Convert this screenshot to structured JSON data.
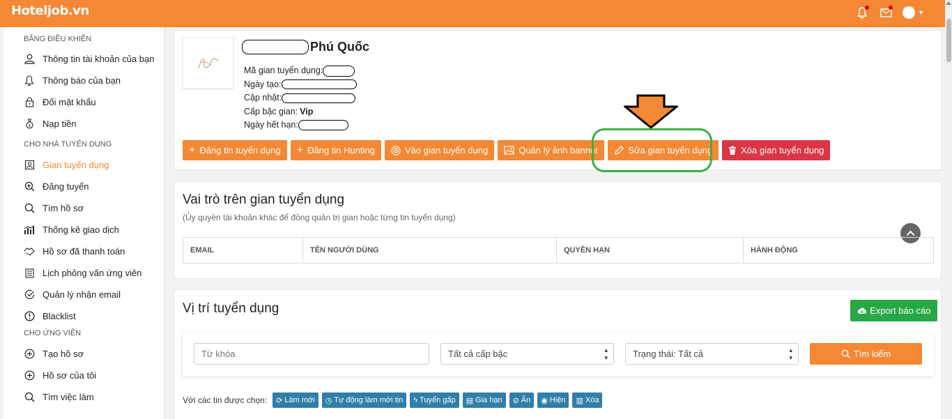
{
  "header": {
    "logo": "Hoteljob.vn",
    "icons": [
      "bell-icon",
      "mail-icon",
      "avatar"
    ],
    "accent": "#f48834"
  },
  "sidebar": {
    "sections": [
      {
        "title": "BẢNG ĐIỀU KHIỂN",
        "items": [
          {
            "label": "Thông tin tài khoản của bạn",
            "icon": "user-icon"
          },
          {
            "label": "Thông báo của bạn",
            "icon": "bell-icon"
          },
          {
            "label": "Đổi mật khẩu",
            "icon": "lock-icon"
          },
          {
            "label": "Nạp tiền",
            "icon": "money-bag-icon"
          }
        ]
      },
      {
        "title": "CHO NHÀ TUYỂN DỤNG",
        "items": [
          {
            "label": "Gian tuyển dụng",
            "icon": "store-icon",
            "active": true
          },
          {
            "label": "Đăng tuyển",
            "icon": "zoom-plus-icon"
          },
          {
            "label": "Tìm hồ sơ",
            "icon": "search-icon"
          },
          {
            "label": "Thống kê giao dịch",
            "icon": "chart-icon"
          },
          {
            "label": "Hồ sơ đã thanh toán",
            "icon": "handshake-icon"
          },
          {
            "label": "Lịch phỏng vấn ứng viên",
            "icon": "calendar-icon"
          },
          {
            "label": "Quản lý nhận email",
            "icon": "check-circle-icon"
          },
          {
            "label": "Blacklist",
            "icon": "alert-circle-icon"
          }
        ]
      },
      {
        "title": "CHO ỨNG VIÊN",
        "items": [
          {
            "label": "Tạo hồ sơ",
            "icon": "plus-circle-icon"
          },
          {
            "label": "Hồ sơ của tôi",
            "icon": "plus-circle-icon"
          },
          {
            "label": "Tìm việc làm",
            "icon": "search-icon"
          }
        ]
      }
    ]
  },
  "profile": {
    "company_name": "Phú Quốc",
    "code_label": "Mã gian tuyển dụng:",
    "created_label": "Ngày tạo:",
    "updated_label": "Cập nhật:",
    "level_label": "Cấp bậc gian:",
    "level_value": "Vip",
    "expiry_label": "Ngày hết hạn:"
  },
  "actions": [
    {
      "label": "Đăng tin tuyển dụng",
      "icon": "plus-icon",
      "style": "primary"
    },
    {
      "label": "Đăng tin Hunting",
      "icon": "plus-icon",
      "style": "primary"
    },
    {
      "label": "Vào gian tuyển dụng",
      "icon": "target-icon",
      "style": "primary"
    },
    {
      "label": "Quản lý ảnh banner",
      "icon": "image-icon",
      "style": "primary"
    },
    {
      "label": "Sửa gian tuyển dụng",
      "icon": "pencil-icon",
      "style": "primary",
      "highlighted": true
    },
    {
      "label": "Xóa gian tuyển dụng",
      "icon": "trash-icon",
      "style": "danger"
    }
  ],
  "roles": {
    "title": "Vai trò trên gian tuyển dụng",
    "subtitle": "(Ủy quyền tài khoản khác để đồng quản trị gian hoặc từng tin tuyển dụng)",
    "columns": [
      "EMAIL",
      "TÊN NGƯỜI DÙNG",
      "QUYỀN HẠN",
      "HÀNH ĐỘNG"
    ]
  },
  "positions": {
    "title": "Vị trí tuyển dụng",
    "export_label": "Export báo cáo",
    "keyword_placeholder": "Từ khóa",
    "level_select": "Tất cả cấp bậc",
    "status_select": "Trạng thái: Tất cả",
    "search_label": "Tìm kiếm",
    "bulk_label": "Với các tin được chọn:",
    "bulk_actions": [
      {
        "label": "Làm mới",
        "icon": "refresh-icon"
      },
      {
        "label": "Tự động làm mới tin",
        "icon": "clock-icon"
      },
      {
        "label": "Tuyển gấp",
        "icon": "bolt-icon"
      },
      {
        "label": "Gia hạn",
        "icon": "card-icon"
      },
      {
        "label": "Ẩn",
        "icon": "eye-slash-icon"
      },
      {
        "label": "Hiện",
        "icon": "eye-icon"
      },
      {
        "label": "Xóa",
        "icon": "trash-icon"
      }
    ]
  }
}
